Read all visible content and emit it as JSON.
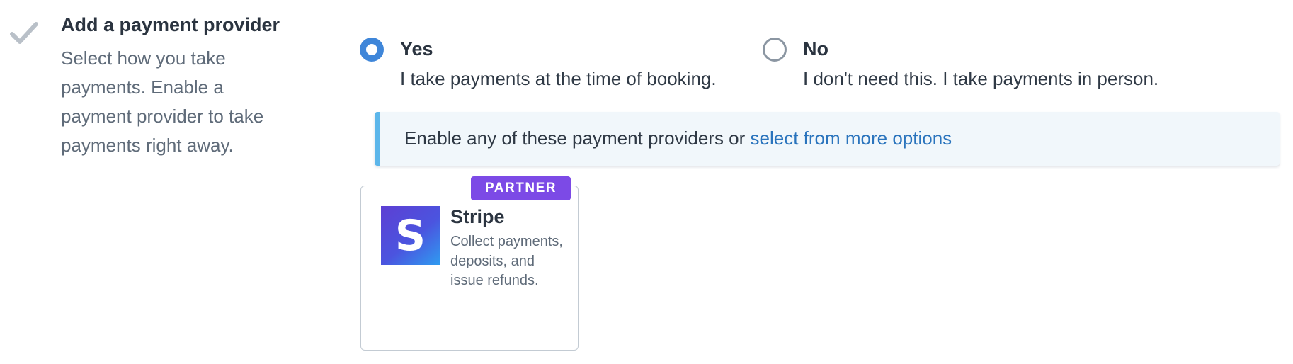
{
  "step": {
    "title": "Add a payment provider",
    "description": "Select how you take payments. Enable a payment provider to take payments right away.",
    "icon": "check-icon"
  },
  "payment_choice": {
    "selected": "yes",
    "options": [
      {
        "label": "Yes",
        "description": "I take payments at the time of booking.",
        "checked": true
      },
      {
        "label": "No",
        "description": "I don't need this. I take payments in person.",
        "checked": false
      }
    ]
  },
  "banner": {
    "text": "Enable any of these payment providers or ",
    "link": "select from more options"
  },
  "providers": [
    {
      "badge": "PARTNER",
      "logo_letter": "S",
      "name": "Stripe",
      "description": "Collect payments, deposits, and issue refunds."
    }
  ],
  "colors": {
    "accent_blue": "#3f86d9",
    "link_blue": "#2a74bd",
    "banner_border": "#5cb6ea",
    "banner_bg": "#f1f7fb",
    "partner_purple": "#7c4ae6",
    "check_gray": "#b9c0c8"
  }
}
